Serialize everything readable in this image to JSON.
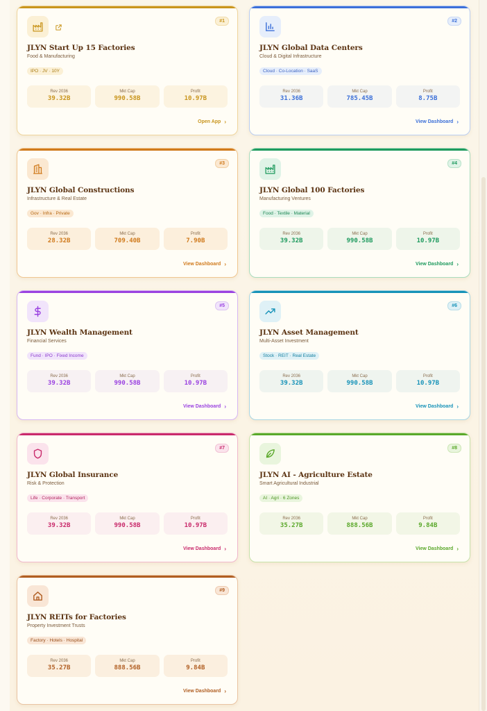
{
  "cards": [
    {
      "rank": "#1",
      "icon": "factory-icon",
      "title": "JLYN Start Up 15 Factories",
      "subtitle": "Food & Manufacturing",
      "tag": "IPO · JV · 10Y",
      "stats": [
        {
          "label": "Rev 2036",
          "value": "39.32B"
        },
        {
          "label": "Mkt Cap",
          "value": "990.58B"
        },
        {
          "label": "Profit",
          "value": "10.97B"
        }
      ],
      "cta": "Open App",
      "accent": "#c9951d"
    },
    {
      "rank": "#2",
      "icon": "bar-chart-icon",
      "title": "JLYN Global Data Centers",
      "subtitle": "Cloud & Digital Infrastructure",
      "tag": "Cloud · Co-Location · SaaS",
      "stats": [
        {
          "label": "Rev 2036",
          "value": "31.36B"
        },
        {
          "label": "Mkt Cap",
          "value": "785.45B"
        },
        {
          "label": "Profit",
          "value": "8.75B"
        }
      ],
      "cta": "View Dashboard",
      "accent": "#3b6fd8"
    },
    {
      "rank": "#3",
      "icon": "building-icon",
      "title": "JLYN Global Constructions",
      "subtitle": "Infrastructure & Real Estate",
      "tag": "Gov · Infra · Private",
      "stats": [
        {
          "label": "Rev 2036",
          "value": "28.32B"
        },
        {
          "label": "Mkt Cap",
          "value": "709.40B"
        },
        {
          "label": "Profit",
          "value": "7.90B"
        }
      ],
      "cta": "View Dashboard",
      "accent": "#d07a1c"
    },
    {
      "rank": "#4",
      "icon": "factory-icon",
      "title": "JLYN Global 100 Factories",
      "subtitle": "Manufacturing Ventures",
      "tag": "Food · Textile · Material",
      "stats": [
        {
          "label": "Rev 2036",
          "value": "39.32B"
        },
        {
          "label": "Mkt Cap",
          "value": "990.58B"
        },
        {
          "label": "Profit",
          "value": "10.97B"
        }
      ],
      "cta": "View Dashboard",
      "accent": "#1e9a5e"
    },
    {
      "rank": "#5",
      "icon": "dollar-icon",
      "title": "JLYN Wealth Management",
      "subtitle": "Financial Services",
      "tag": "Fund · IPO · Fixed Income",
      "stats": [
        {
          "label": "Rev 2036",
          "value": "39.32B"
        },
        {
          "label": "Mkt Cap",
          "value": "990.58B"
        },
        {
          "label": "Profit",
          "value": "10.97B"
        }
      ],
      "cta": "View Dashboard",
      "accent": "#9a42e0"
    },
    {
      "rank": "#6",
      "icon": "trending-up-icon",
      "title": "JLYN Asset Management",
      "subtitle": "Multi-Asset Investment",
      "tag": "Stock · REIT · Real Estate",
      "stats": [
        {
          "label": "Rev 2036",
          "value": "39.32B"
        },
        {
          "label": "Mkt Cap",
          "value": "990.58B"
        },
        {
          "label": "Profit",
          "value": "10.97B"
        }
      ],
      "cta": "View Dashboard",
      "accent": "#1692b8"
    },
    {
      "rank": "#7",
      "icon": "shield-icon",
      "title": "JLYN Global Insurance",
      "subtitle": "Risk & Protection",
      "tag": "Life · Corporate · Transport",
      "stats": [
        {
          "label": "Rev 2036",
          "value": "39.32B"
        },
        {
          "label": "Mkt Cap",
          "value": "990.58B"
        },
        {
          "label": "Profit",
          "value": "10.97B"
        }
      ],
      "cta": "View Dashboard",
      "accent": "#c92a6b"
    },
    {
      "rank": "#8",
      "icon": "leaf-icon",
      "title": "JLYN AI - Agriculture Estate",
      "subtitle": "Smart Agricultural Industrial",
      "tag": "AI · Agri · 6 Zones",
      "stats": [
        {
          "label": "Rev 2036",
          "value": "35.27B"
        },
        {
          "label": "Mkt Cap",
          "value": "888.56B"
        },
        {
          "label": "Profit",
          "value": "9.84B"
        }
      ],
      "cta": "View Dashboard",
      "accent": "#5aa82a"
    },
    {
      "rank": "#9",
      "icon": "home-icon",
      "title": "JLYN REITs for Factories",
      "subtitle": "Property Investment Trusts",
      "tag": "Factory · Hotels · Hospital",
      "stats": [
        {
          "label": "Rev 2036",
          "value": "35.27B"
        },
        {
          "label": "Mkt Cap",
          "value": "888.56B"
        },
        {
          "label": "Profit",
          "value": "9.84B"
        }
      ],
      "cta": "View Dashboard",
      "accent": "#b05e22"
    }
  ]
}
